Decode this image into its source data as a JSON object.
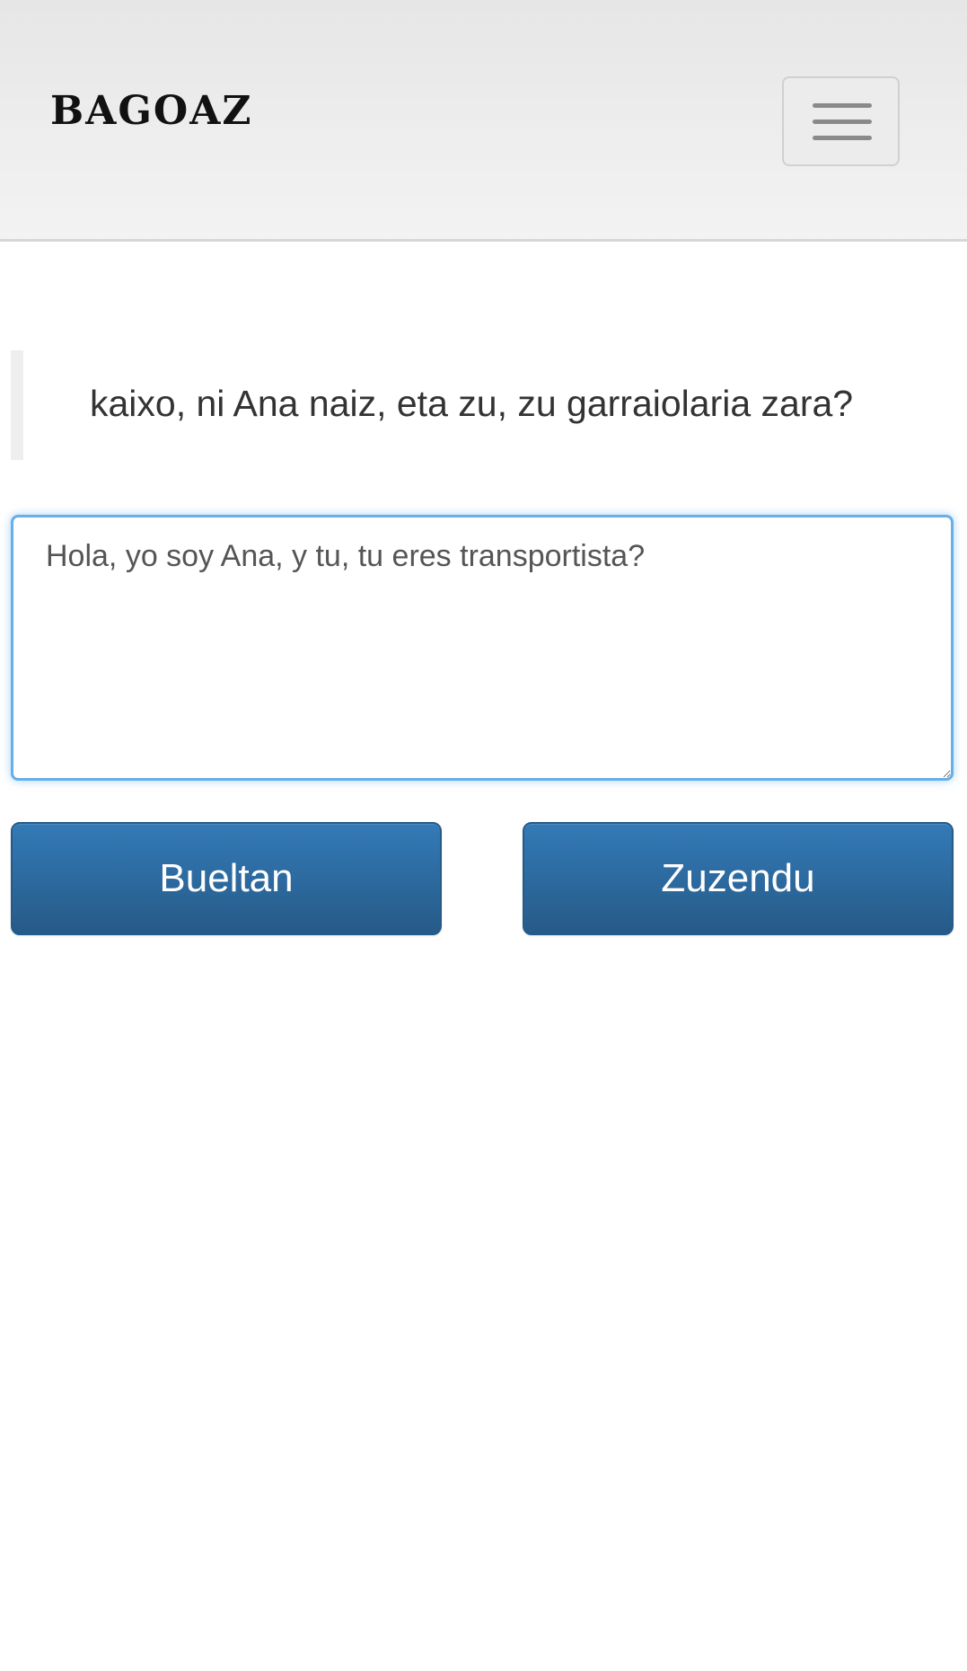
{
  "navbar": {
    "brand": "BAGOAZ",
    "menu_toggle_icon": "hamburger-icon"
  },
  "exercise": {
    "prompt": "kaixo, ni Ana naiz, eta zu, zu garraiolaria zara?",
    "answer_value": "Hola, yo soy Ana, y tu, tu eres transportista?"
  },
  "actions": {
    "back_label": "Bueltan",
    "correct_label": "Zuzendu"
  },
  "colors": {
    "button_top": "#337ab7",
    "button_bottom": "#265a88",
    "focus_border": "#66afe9"
  }
}
